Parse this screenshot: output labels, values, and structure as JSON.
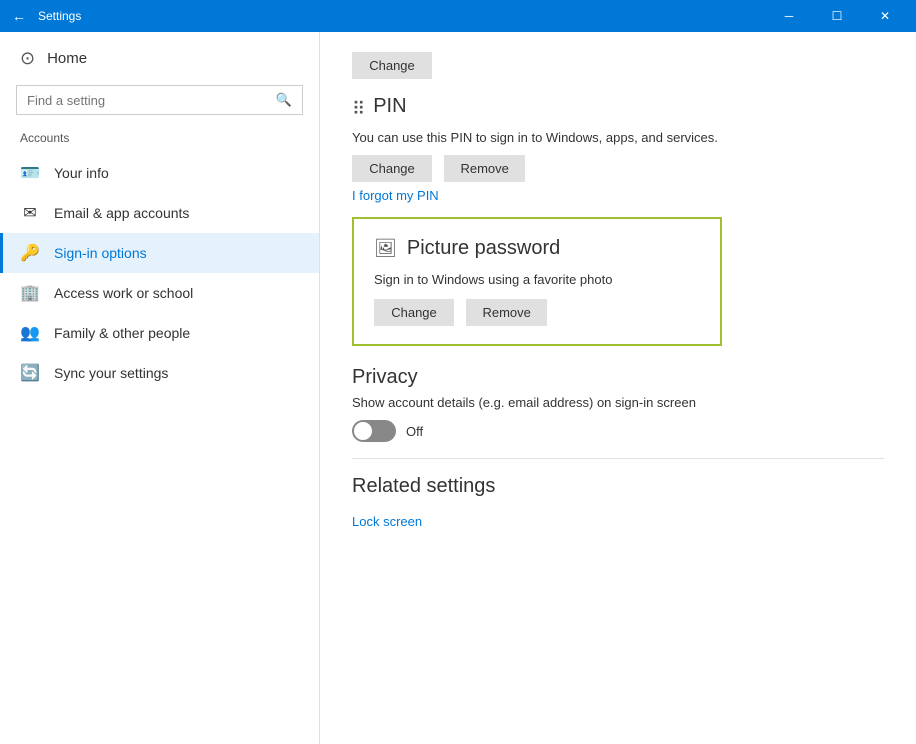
{
  "titlebar": {
    "title": "Settings",
    "back_label": "←",
    "minimize_label": "─",
    "maximize_label": "☐",
    "close_label": "✕"
  },
  "sidebar": {
    "home_label": "Home",
    "search_placeholder": "Find a setting",
    "section_label": "Accounts",
    "nav_items": [
      {
        "id": "your-info",
        "label": "Your info",
        "icon": "👤"
      },
      {
        "id": "email-app-accounts",
        "label": "Email & app accounts",
        "icon": "✉"
      },
      {
        "id": "sign-in-options",
        "label": "Sign-in options",
        "icon": "🔑",
        "active": true
      },
      {
        "id": "access-work-school",
        "label": "Access work or school",
        "icon": "💼"
      },
      {
        "id": "family-other",
        "label": "Family & other people",
        "icon": "👥"
      },
      {
        "id": "sync-settings",
        "label": "Sync your settings",
        "icon": "🔄"
      }
    ]
  },
  "content": {
    "top_change_btn": "Change",
    "pin_section": {
      "title": "PIN",
      "desc": "You can use this PIN to sign in to Windows, apps, and services.",
      "change_btn": "Change",
      "remove_btn": "Remove",
      "forgot_link": "I forgot my PIN"
    },
    "picture_password_section": {
      "title": "Picture password",
      "desc": "Sign in to Windows using a favorite photo",
      "change_btn": "Change",
      "remove_btn": "Remove"
    },
    "privacy_section": {
      "title": "Privacy",
      "desc": "Show account details (e.g. email address) on sign-in screen",
      "toggle_state": "Off"
    },
    "related_settings": {
      "title": "Related settings",
      "lock_screen_link": "Lock screen"
    }
  }
}
